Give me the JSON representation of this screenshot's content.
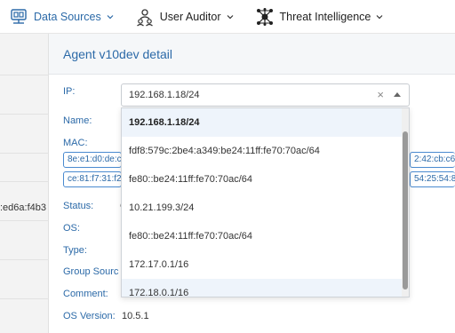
{
  "nav": {
    "items": [
      {
        "label": "Data Sources",
        "icon": "data-sources-icon"
      },
      {
        "label": "User Auditor",
        "icon": "user-auditor-icon"
      },
      {
        "label": "Threat Intelligence",
        "icon": "threat-intelligence-icon"
      }
    ]
  },
  "left": {
    "partial_text": ":ed6a:f4b3"
  },
  "panel": {
    "title": "Agent v10dev detail",
    "labels": {
      "ip": "IP:",
      "name": "Name:",
      "mac": "MAC:",
      "status": "Status:",
      "os": "OS:",
      "type": "Type:",
      "group_source": "Group Sourc",
      "comment": "Comment:",
      "os_version": "OS Version:"
    },
    "status_value_partial": "C",
    "os_version_value": "10.5.1",
    "mac_chips": [
      {
        "left": "8e:e1:d0:de:c",
        "right": "2:42:cb:c6"
      },
      {
        "left": "ce:81:f7:31:f2:",
        "right": "54:25:54:8"
      }
    ]
  },
  "ip_select": {
    "value": "192.168.1.18/24",
    "clear_label": "×"
  },
  "ip_options": [
    "192.168.1.18/24",
    "fdf8:579c:2be4:a349:be24:11ff:fe70:70ac/64",
    "fe80::be24:11ff:fe70:70ac/64",
    "10.21.199.3/24",
    "fe80::be24:11ff:fe70:70ac/64",
    "172.17.0.1/16",
    "172.18.0.1/16"
  ],
  "colors": {
    "accent": "#2c6aa8",
    "chip_border": "#4a8ad0",
    "selected_bg": "#eef4fb"
  }
}
